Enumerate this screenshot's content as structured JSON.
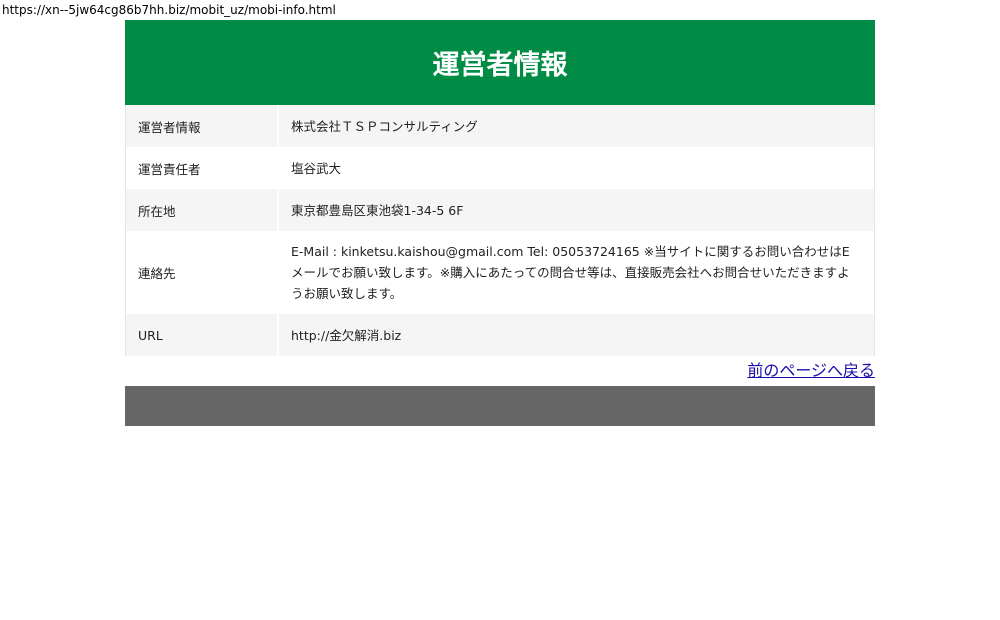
{
  "browser": {
    "url": "https://xn--5jw64cg86b7hh.biz/mobit_uz/mobi-info.html"
  },
  "header": {
    "title": "運営者情報"
  },
  "rows": [
    {
      "label": "運営者情報",
      "value": "株式会社ＴＳＰコンサルティング"
    },
    {
      "label": "運営責任者",
      "value": "塩谷武大"
    },
    {
      "label": "所在地",
      "value": "東京都豊島区東池袋1-34-5 6F"
    },
    {
      "label": "連絡先",
      "value": "E-Mail : kinketsu.kaishou@gmail.com Tel: 05053724165 ※当サイトに関するお問い合わせはEメールでお願い致します。※購入にあたっての問合せ等は、直接販売会社へお問合せいただきますようお願い致します。"
    },
    {
      "label": "URL",
      "value": "http://金欠解消.biz"
    }
  ],
  "back_link": "前のページへ戻る"
}
